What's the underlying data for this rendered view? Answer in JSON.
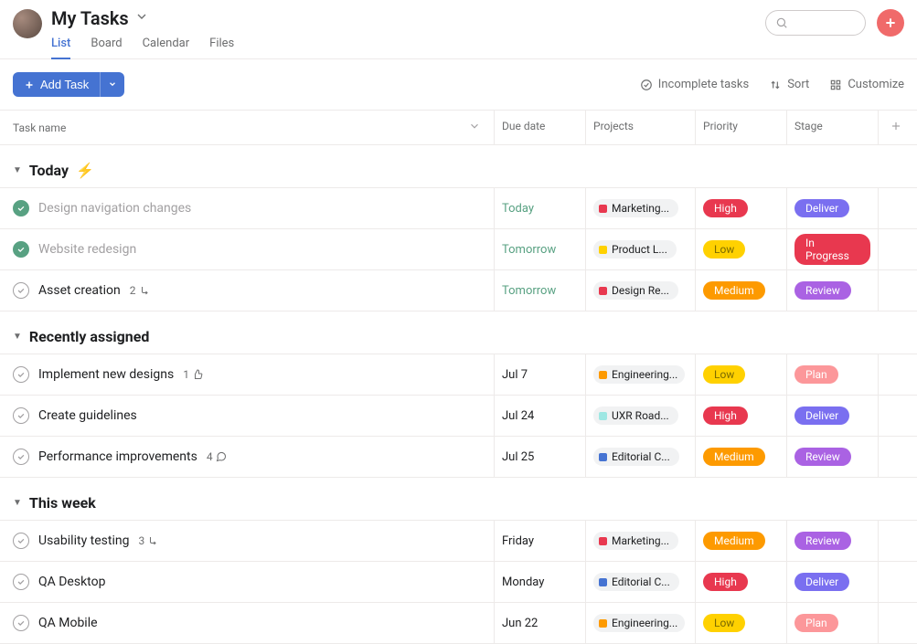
{
  "header": {
    "title": "My Tasks",
    "tabs": [
      {
        "label": "List",
        "active": true
      },
      {
        "label": "Board",
        "active": false
      },
      {
        "label": "Calendar",
        "active": false
      },
      {
        "label": "Files",
        "active": false
      }
    ]
  },
  "toolbar": {
    "add_label": "Add Task",
    "incomplete_label": "Incomplete tasks",
    "sort_label": "Sort",
    "customize_label": "Customize"
  },
  "columns": {
    "name": "Task name",
    "due": "Due date",
    "projects": "Projects",
    "priority": "Priority",
    "stage": "Stage"
  },
  "colors": {
    "High": "#e8384f",
    "Medium": "#fd9a00",
    "Low": "#ffd100",
    "Deliver": "#7a6ff0",
    "In Progress": "#e8384f",
    "Review": "#aa62e3",
    "Plan": "#fc979a",
    "LowText": "#7b6a00"
  },
  "project_colors": {
    "Marketing...": "#e8384f",
    "Product L...": "#ffd100",
    "Design Re...": "#e8384f",
    "Engineering...": "#fd9a00",
    "UXR Road...": "#9ee7e3",
    "Editorial C...": "#4573d2"
  },
  "sections": [
    {
      "title": "Today",
      "bolt": true,
      "tasks": [
        {
          "done": true,
          "name": "Design navigation changes",
          "due": "Today",
          "due_style": "green",
          "project": "Marketing...",
          "priority": "High",
          "stage": "Deliver"
        },
        {
          "done": true,
          "name": "Website redesign",
          "due": "Tomorrow",
          "due_style": "green",
          "project": "Product L...",
          "priority": "Low",
          "stage": "In Progress"
        },
        {
          "done": false,
          "name": "Asset creation",
          "due": "Tomorrow",
          "due_style": "green",
          "project": "Design Re...",
          "priority": "Medium",
          "stage": "Review",
          "meta_count": "2",
          "meta_icon": "subtask"
        }
      ]
    },
    {
      "title": "Recently assigned",
      "bolt": false,
      "tasks": [
        {
          "done": false,
          "name": "Implement new designs",
          "due": "Jul 7",
          "due_style": "normal",
          "project": "Engineering...",
          "priority": "Low",
          "stage": "Plan",
          "meta_count": "1",
          "meta_icon": "like"
        },
        {
          "done": false,
          "name": "Create guidelines",
          "due": "Jul 24",
          "due_style": "normal",
          "project": "UXR Road...",
          "priority": "High",
          "stage": "Deliver"
        },
        {
          "done": false,
          "name": "Performance improvements",
          "due": "Jul 25",
          "due_style": "normal",
          "project": "Editorial C...",
          "priority": "Medium",
          "stage": "Review",
          "meta_count": "4",
          "meta_icon": "comment"
        }
      ]
    },
    {
      "title": "This week",
      "bolt": false,
      "tasks": [
        {
          "done": false,
          "name": "Usability testing",
          "due": "Friday",
          "due_style": "normal",
          "project": "Marketing...",
          "priority": "Medium",
          "stage": "Review",
          "meta_count": "3",
          "meta_icon": "subtask"
        },
        {
          "done": false,
          "name": "QA Desktop",
          "due": "Monday",
          "due_style": "normal",
          "project": "Editorial C...",
          "priority": "High",
          "stage": "Deliver"
        },
        {
          "done": false,
          "name": "QA Mobile",
          "due": "Jun 22",
          "due_style": "normal",
          "project": "Engineering...",
          "priority": "Low",
          "stage": "Plan"
        }
      ]
    }
  ]
}
